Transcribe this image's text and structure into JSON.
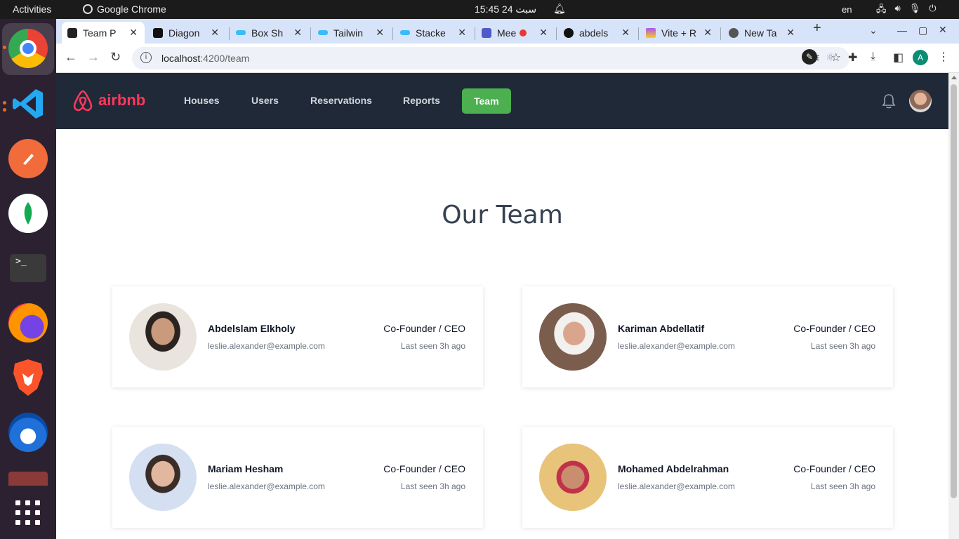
{
  "system": {
    "activities": "Activities",
    "app_name": "Google Chrome",
    "clock": "15:45  24 سبت",
    "lang": "en"
  },
  "browser": {
    "tabs": [
      {
        "title": "Team P",
        "color": "#222"
      },
      {
        "title": "Diagon",
        "color": "#111"
      },
      {
        "title": "Box Sh",
        "color": "#38bdf8"
      },
      {
        "title": "Tailwin",
        "color": "#38bdf8"
      },
      {
        "title": "Stacke",
        "color": "#38bdf8"
      },
      {
        "title": "Mee",
        "color": "#5059c9"
      },
      {
        "title": "abdels",
        "color": "#111"
      },
      {
        "title": "Vite + R",
        "color": "#a855f7"
      },
      {
        "title": "New Ta",
        "color": "#555"
      }
    ],
    "url_host": "localhost",
    "url_path": ":4200/team",
    "profile_initial": "A"
  },
  "app": {
    "logo_text": "airbnb",
    "nav": [
      "Houses",
      "Users",
      "Reservations",
      "Reports",
      "Team"
    ],
    "active_nav": "Team",
    "accent": "#4caf50",
    "nav_bg": "#1f2937"
  },
  "team": {
    "title": "Our Team",
    "members": [
      {
        "name": "Abdelslam Elkholy",
        "email": "leslie.alexander@example.com",
        "role": "Co-Founder / CEO",
        "seen": "Last seen 3h ago"
      },
      {
        "name": "Kariman Abdellatif",
        "email": "leslie.alexander@example.com",
        "role": "Co-Founder / CEO",
        "seen": "Last seen 3h ago"
      },
      {
        "name": "Mariam Hesham",
        "email": "leslie.alexander@example.com",
        "role": "Co-Founder / CEO",
        "seen": "Last seen 3h ago"
      },
      {
        "name": "Mohamed Abdelrahman",
        "email": "leslie.alexander@example.com",
        "role": "Co-Founder / CEO",
        "seen": "Last seen 3h ago"
      }
    ]
  }
}
